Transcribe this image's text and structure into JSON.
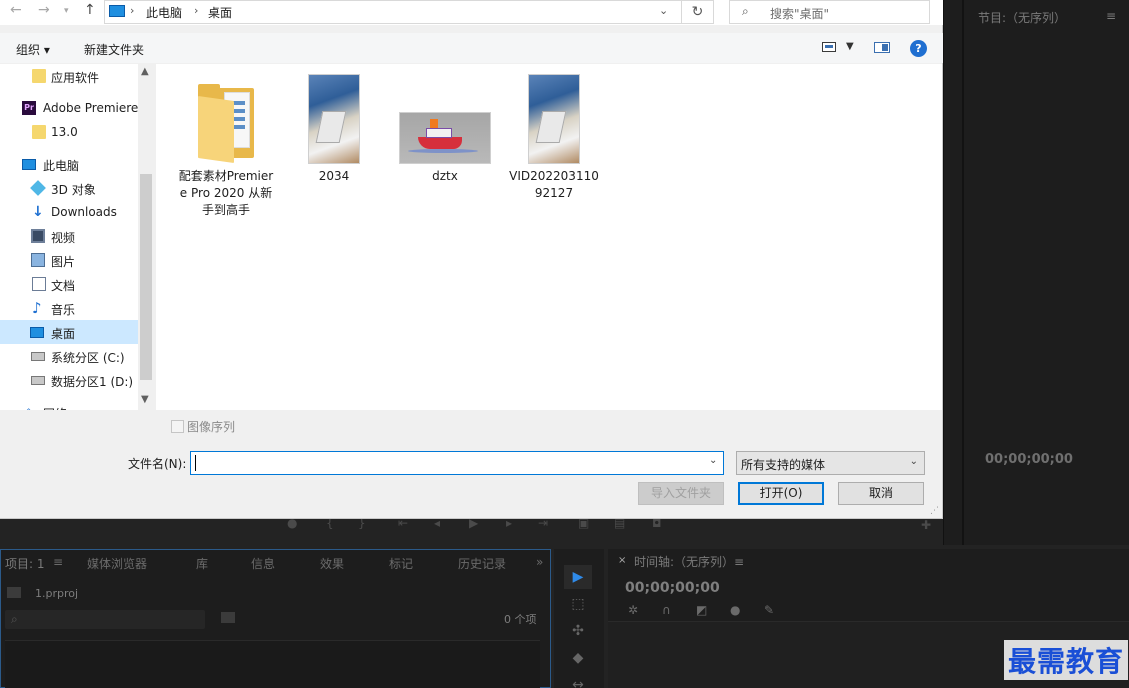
{
  "dialog": {
    "address": {
      "crumbs": [
        "此电脑",
        "桌面"
      ],
      "search_placeholder": "搜索\"桌面\""
    },
    "toolbar": {
      "organize": "组织 ▾",
      "new_folder": "新建文件夹"
    },
    "nav": [
      {
        "label": "应用软件",
        "icon": "folder"
      },
      {
        "label": "Adobe Premiere",
        "icon": "premiere"
      },
      {
        "label": "13.0",
        "icon": "folder"
      },
      {
        "label": "此电脑",
        "icon": "computer"
      },
      {
        "label": "3D 对象",
        "icon": "3d"
      },
      {
        "label": "Downloads",
        "icon": "download"
      },
      {
        "label": "视频",
        "icon": "video"
      },
      {
        "label": "图片",
        "icon": "pictures"
      },
      {
        "label": "文档",
        "icon": "documents"
      },
      {
        "label": "音乐",
        "icon": "music"
      },
      {
        "label": "桌面",
        "icon": "desktop"
      },
      {
        "label": "系统分区 (C:)",
        "icon": "drive"
      },
      {
        "label": "数据分区1 (D:)",
        "icon": "drive"
      },
      {
        "label": "网络",
        "icon": "network"
      }
    ],
    "files": [
      {
        "name": "配套素材Premiere Pro 2020 从新手到高手",
        "type": "folder"
      },
      {
        "name": "2034",
        "type": "video"
      },
      {
        "name": "dztx",
        "type": "image"
      },
      {
        "name": "VID20220311092127",
        "type": "video"
      }
    ],
    "image_sequence_label": "图像序列",
    "filename_label": "文件名(N):",
    "filename_value": "",
    "filetype_value": "所有支持的媒体",
    "buttons": {
      "import_folder": "导入文件夹",
      "open": "打开(O)",
      "cancel": "取消"
    }
  },
  "premiere": {
    "program_monitor_title": "节目:（无序列）",
    "program_menu": "≡",
    "program_timecode": "00;00;00;00",
    "project_tabs": [
      "项目: 1",
      "≡",
      "媒体浏览器",
      "库",
      "信息",
      "效果",
      "标记",
      "历史记录",
      "»"
    ],
    "project_file": "1.prproj",
    "project_item_count": "0 个项",
    "timeline_title": "时间轴:（无序列）≡",
    "timeline_close": "×",
    "timeline_timecode": "00;00;00;00"
  },
  "watermark": "最需教育",
  "colors": {
    "accent": "#0078d7",
    "selection": "#cce8ff",
    "premiere_bg": "#232323",
    "watermark": "#1a4fd6"
  }
}
